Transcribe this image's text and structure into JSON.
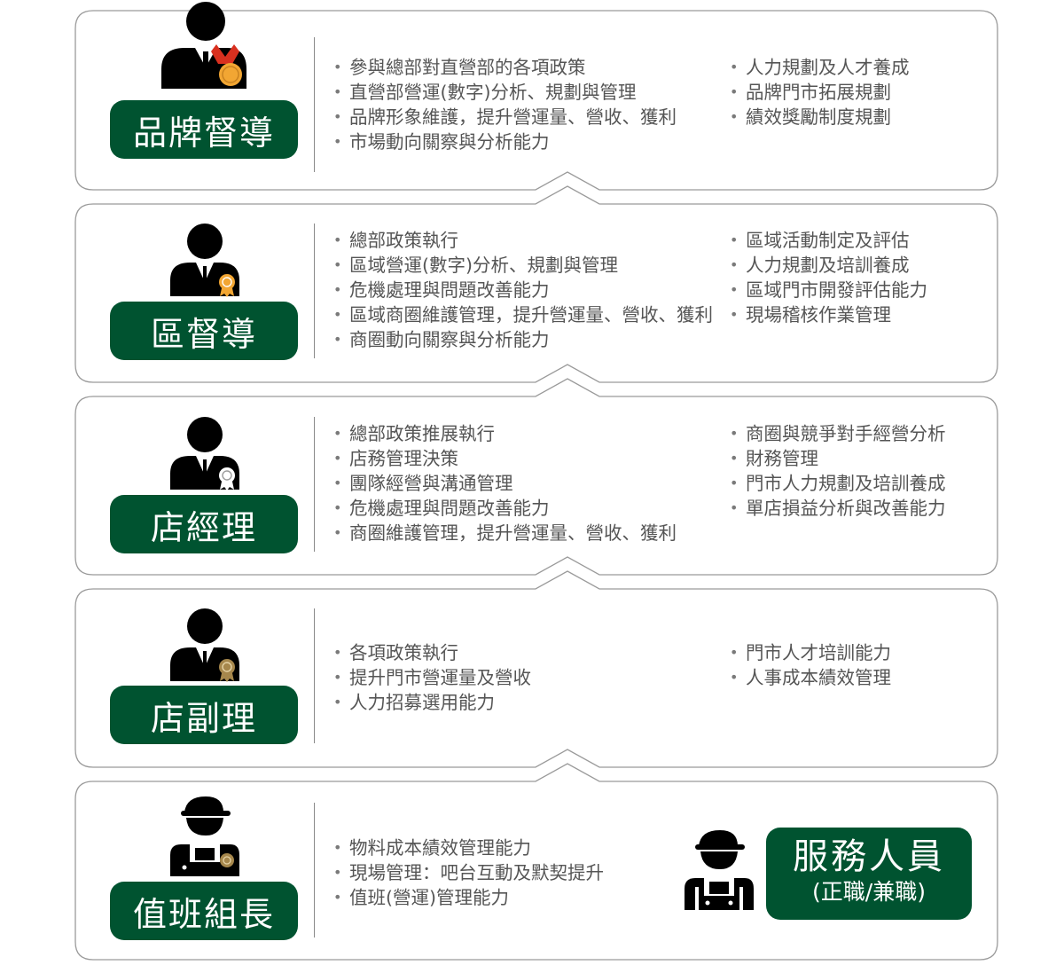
{
  "levels": [
    {
      "title": "品牌督導",
      "col1": [
        "參與總部對直營部的各項政策",
        "直營部營運(數字)分析、規劃與管理",
        "品牌形象維護，提升營運量、營收、獲利",
        "市場動向關察與分析能力"
      ],
      "col2": [
        "人力規劃及人才養成",
        "品牌門市拓展規劃",
        "績效獎勵制度規劃"
      ]
    },
    {
      "title": "區督導",
      "col1": [
        "總部政策執行",
        "區域營運(數字)分析、規劃與管理",
        "危機處理與問題改善能力",
        "區域商圈維護管理，提升營運量、營收、獲利",
        "商圈動向關察與分析能力"
      ],
      "col2": [
        "區域活動制定及評估",
        "人力規劃及培訓養成",
        "區域門市開發評估能力",
        "現場稽核作業管理"
      ]
    },
    {
      "title": "店經理",
      "col1": [
        "總部政策推展執行",
        "店務管理決策",
        "團隊經營與溝通管理",
        "危機處理與問題改善能力",
        "商圈維護管理，提升營運量、營收、獲利"
      ],
      "col2": [
        "商圈與競爭對手經營分析",
        "財務管理",
        "門市人力規劃及培訓養成",
        "單店損益分析與改善能力"
      ]
    },
    {
      "title": "店副理",
      "col1": [
        "各項政策執行",
        "提升門市營運量及營收",
        "人力招募選用能力"
      ],
      "col2": [
        "門市人才培訓能力",
        "人事成本績效管理"
      ]
    },
    {
      "title": "值班組長",
      "col1": [
        "物料成本績效管理能力",
        "現場管理：吧台互動及默契提升",
        "值班(營運)管理能力"
      ],
      "col2": []
    }
  ],
  "staff": {
    "line1": "服務人員",
    "line2": "(正職/兼職)"
  },
  "colors": {
    "brand_green": "#005330",
    "text_gray": "#555555",
    "frame_gray": "#9a9a9a",
    "medal_gold": "#f2a633",
    "ribbon_red": "#d9301f"
  },
  "icons": [
    "manager-medal-icon",
    "supervisor-badge-icon",
    "store-manager-badge-icon",
    "assistant-manager-badge-icon",
    "shift-leader-cap-icon",
    "service-staff-cap-icon"
  ]
}
